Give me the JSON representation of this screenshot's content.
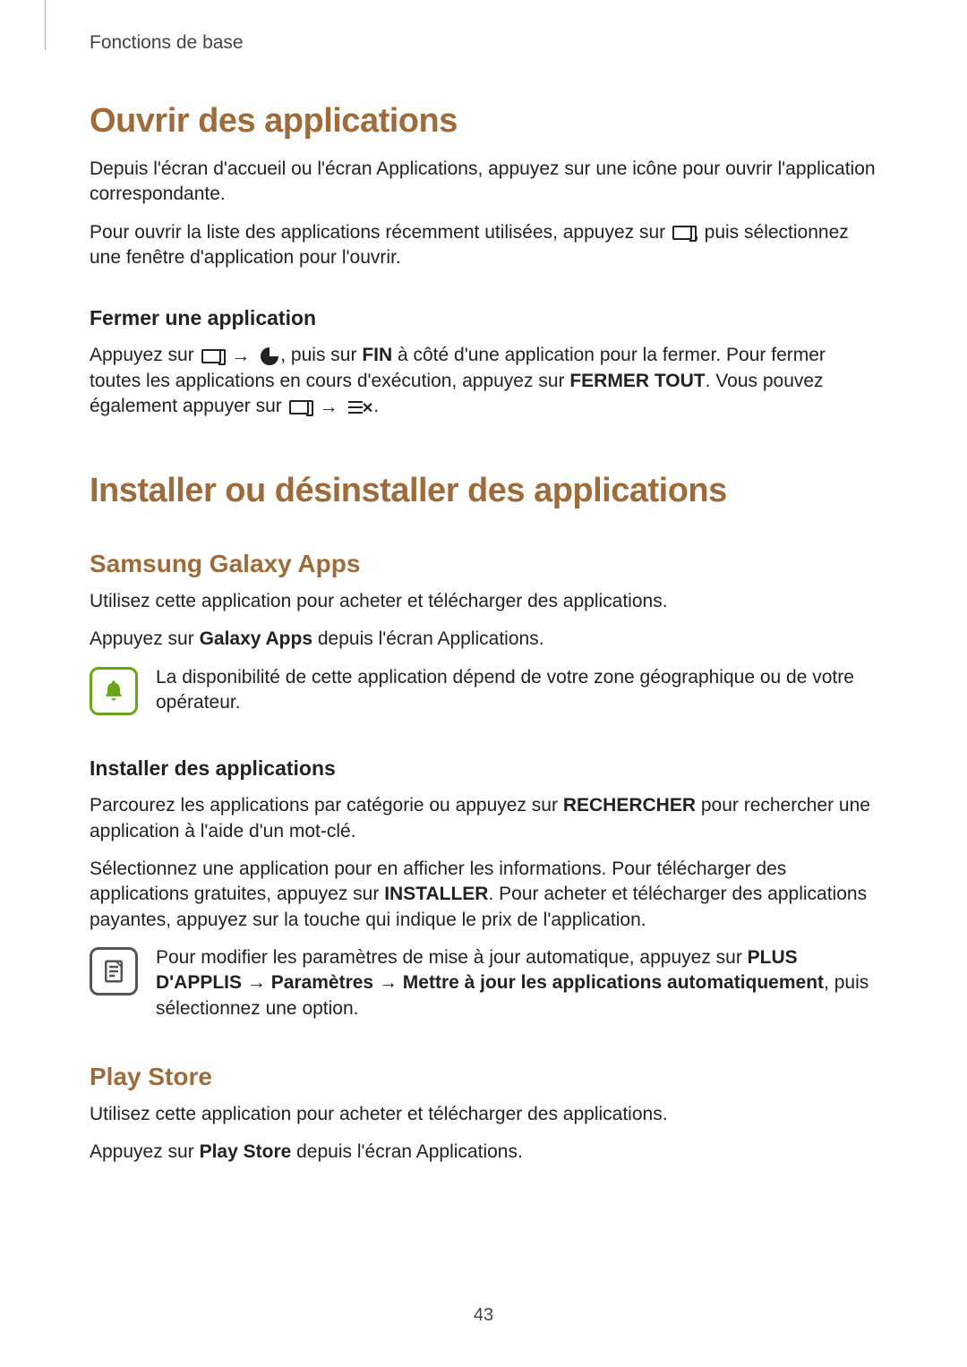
{
  "header": {
    "chapter": "Fonctions de base"
  },
  "s1": {
    "title": "Ouvrir des applications",
    "p1": "Depuis l'écran d'accueil ou l'écran Applications, appuyez sur une icône pour ouvrir l'application correspondante.",
    "p2a": "Pour ouvrir la liste des applications récemment utilisées, appuyez sur ",
    "p2b": ", puis sélectionnez une fenêtre d'application pour l'ouvrir.",
    "sub1": {
      "title": "Fermer une application",
      "p1a": "Appuyez sur ",
      "p1b": ", puis sur ",
      "p1c_bold": "FIN",
      "p1d": " à côté d'une application pour la fermer. Pour fermer toutes les applications en cours d'exécution, appuyez sur ",
      "p1e_bold": "FERMER TOUT",
      "p1f": ". Vous pouvez également appuyer sur ",
      "p1g": "."
    }
  },
  "s2": {
    "title": "Installer ou désinstaller des applications",
    "sub1": {
      "title": "Samsung Galaxy Apps",
      "p1": "Utilisez cette application pour acheter et télécharger des applications.",
      "p2a": "Appuyez sur ",
      "p2b_bold": "Galaxy Apps",
      "p2c": " depuis l'écran Applications.",
      "note": "La disponibilité de cette application dépend de votre zone géographique ou de votre opérateur.",
      "h3": "Installer des applications",
      "p3a": "Parcourez les applications par catégorie ou appuyez sur ",
      "p3b_bold": "RECHERCHER",
      "p3c": " pour rechercher une application à l'aide d'un mot-clé.",
      "p4a": "Sélectionnez une application pour en afficher les informations. Pour télécharger des applications gratuites, appuyez sur ",
      "p4b_bold": "INSTALLER",
      "p4c": ". Pour acheter et télécharger des applications payantes, appuyez sur la touche qui indique le prix de l'application.",
      "note2a": "Pour modifier les paramètres de mise à jour automatique, appuyez sur ",
      "note2b_bold": "PLUS D'APPLIS",
      "note2c": " → ",
      "note2d_bold": "Paramètres",
      "note2e": " → ",
      "note2f_bold": "Mettre à jour les applications automatiquement",
      "note2g": ", puis sélectionnez une option."
    },
    "sub2": {
      "title": "Play Store",
      "p1": "Utilisez cette application pour acheter et télécharger des applications.",
      "p2a": "Appuyez sur ",
      "p2b_bold": "Play Store",
      "p2c": " depuis l'écran Applications."
    }
  },
  "page_number": "43",
  "icons": {
    "recent": "recent-apps-icon",
    "arrow": "→",
    "pie": "task-manager-icon",
    "closeall": "close-all-icon",
    "bell": "note-bell-icon",
    "page": "note-page-icon"
  }
}
